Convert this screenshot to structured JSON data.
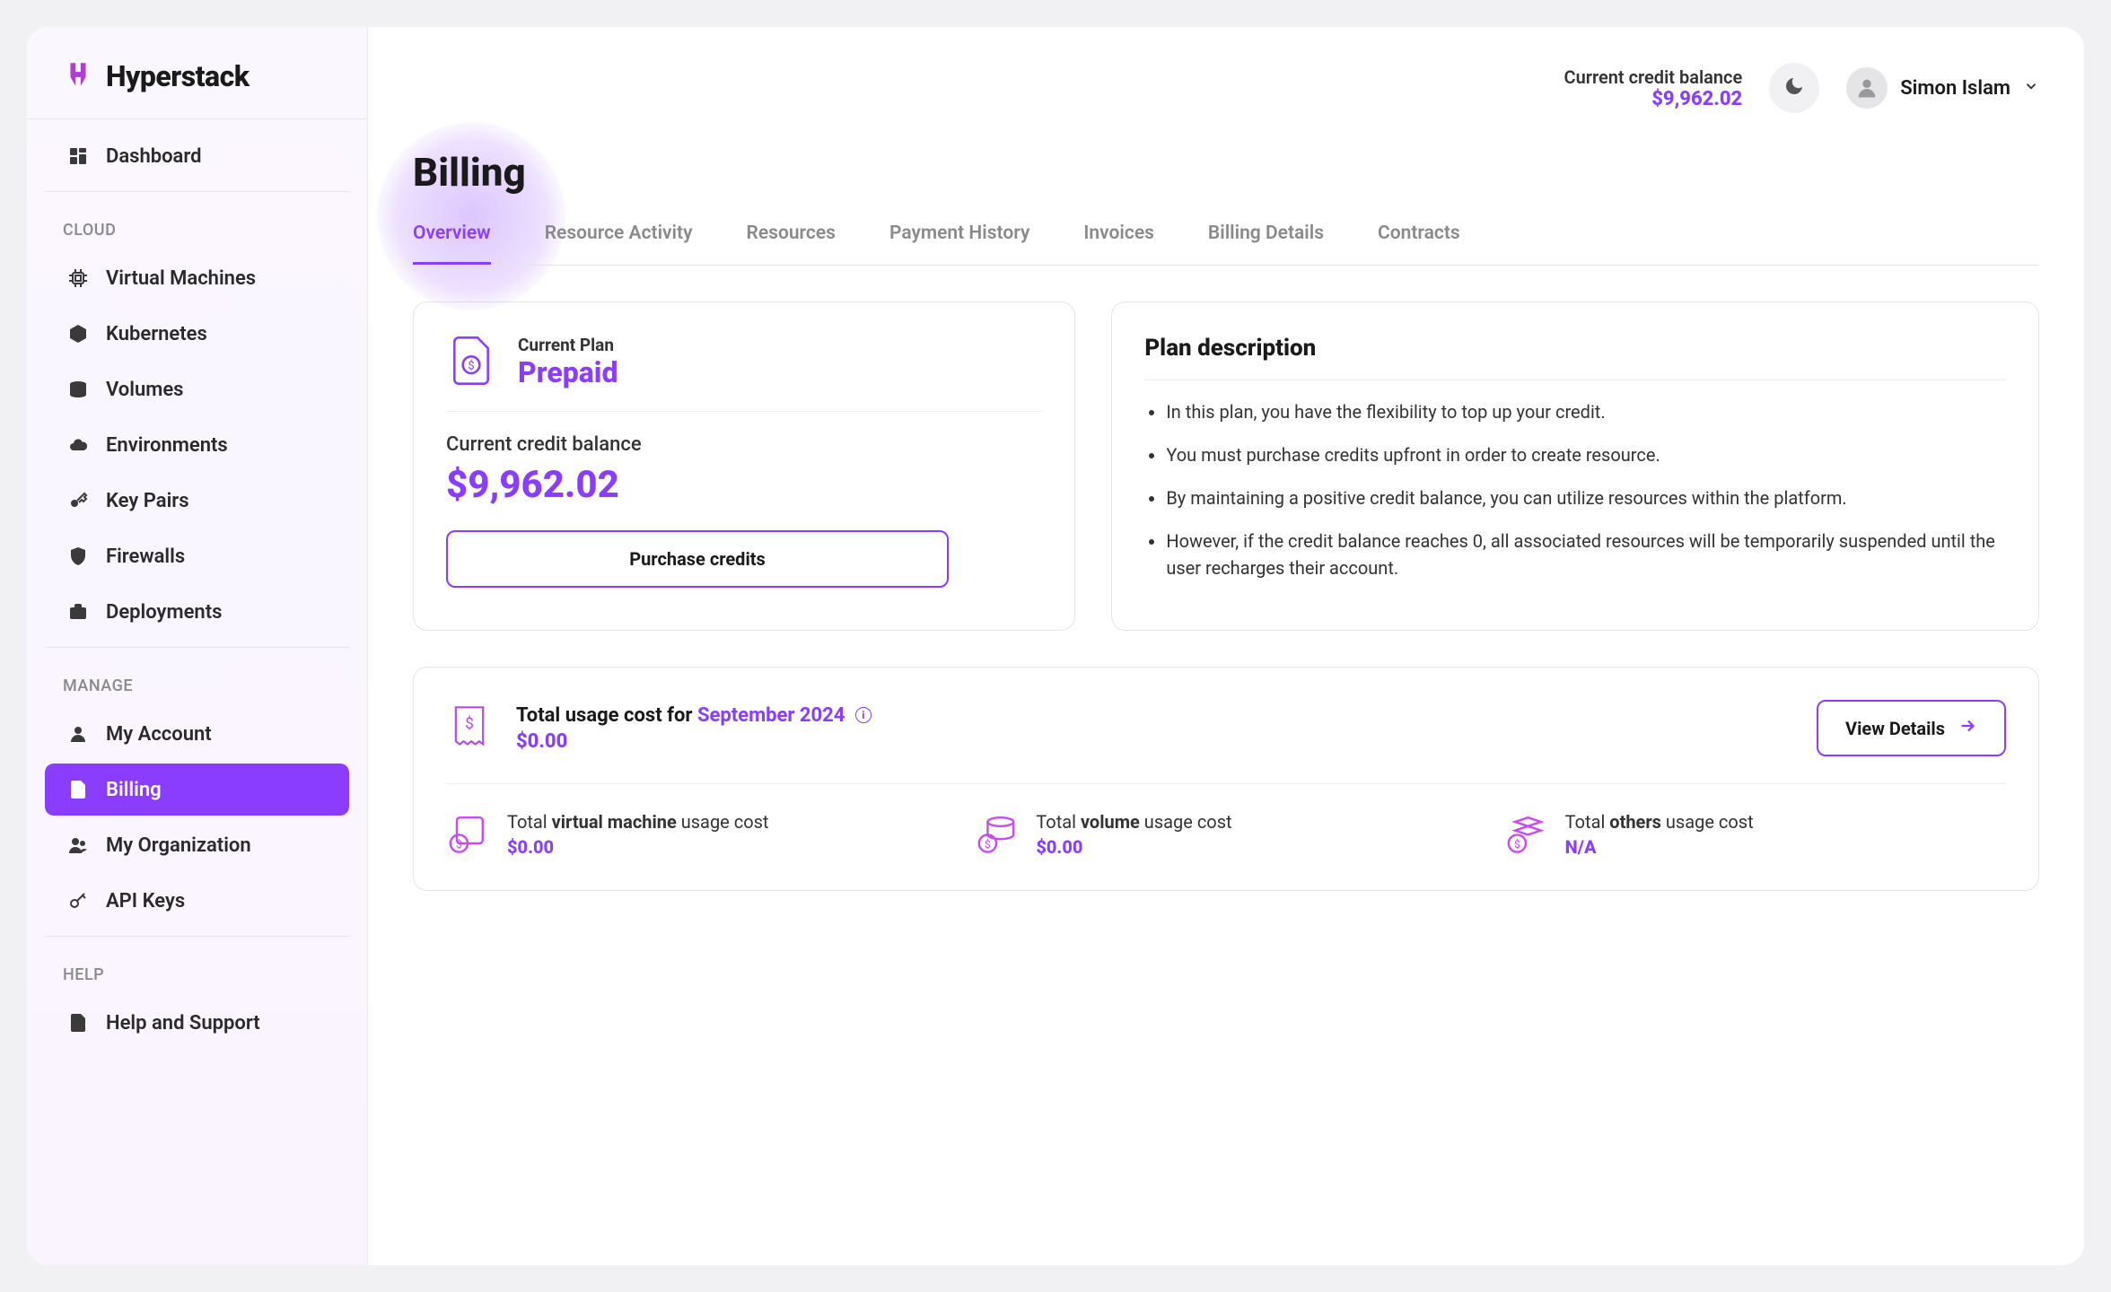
{
  "brand": "Hyperstack",
  "header": {
    "balance_label": "Current credit balance",
    "balance_amount": "$9,962.02",
    "user_name": "Simon Islam"
  },
  "sidebar": {
    "dashboard": "Dashboard",
    "sections": {
      "cloud": {
        "label": "CLOUD",
        "items": [
          "Virtual Machines",
          "Kubernetes",
          "Volumes",
          "Environments",
          "Key Pairs",
          "Firewalls",
          "Deployments"
        ]
      },
      "manage": {
        "label": "MANAGE",
        "items": [
          "My Account",
          "Billing",
          "My Organization",
          "API Keys"
        ],
        "active_index": 1
      },
      "help": {
        "label": "HELP",
        "items": [
          "Help and Support"
        ]
      }
    }
  },
  "page": {
    "title": "Billing",
    "tabs": [
      "Overview",
      "Resource Activity",
      "Resources",
      "Payment History",
      "Invoices",
      "Billing Details",
      "Contracts"
    ],
    "active_tab_index": 0
  },
  "plan_card": {
    "label": "Current Plan",
    "name": "Prepaid",
    "cc_label": "Current credit balance",
    "cc_amount": "$9,962.02",
    "button": "Purchase credits"
  },
  "desc_card": {
    "title": "Plan description",
    "bullets": [
      "In this plan, you have the flexibility to top up your credit.",
      "You must purchase credits upfront in order to create resource.",
      "By maintaining a positive credit balance, you can utilize resources within the platform.",
      "However, if the credit balance reaches 0, all associated resources will be temporarily suspended until the user recharges their account."
    ]
  },
  "usage": {
    "title_prefix": "Total usage cost for ",
    "month": "September 2024",
    "total": "$0.00",
    "view_details": "View Details",
    "items": [
      {
        "pre": "Total ",
        "bold": "virtual machine",
        "post": " usage cost",
        "value": "$0.00"
      },
      {
        "pre": "Total ",
        "bold": "volume",
        "post": " usage cost",
        "value": "$0.00"
      },
      {
        "pre": "Total ",
        "bold": "others",
        "post": " usage cost",
        "value": "N/A"
      }
    ]
  }
}
